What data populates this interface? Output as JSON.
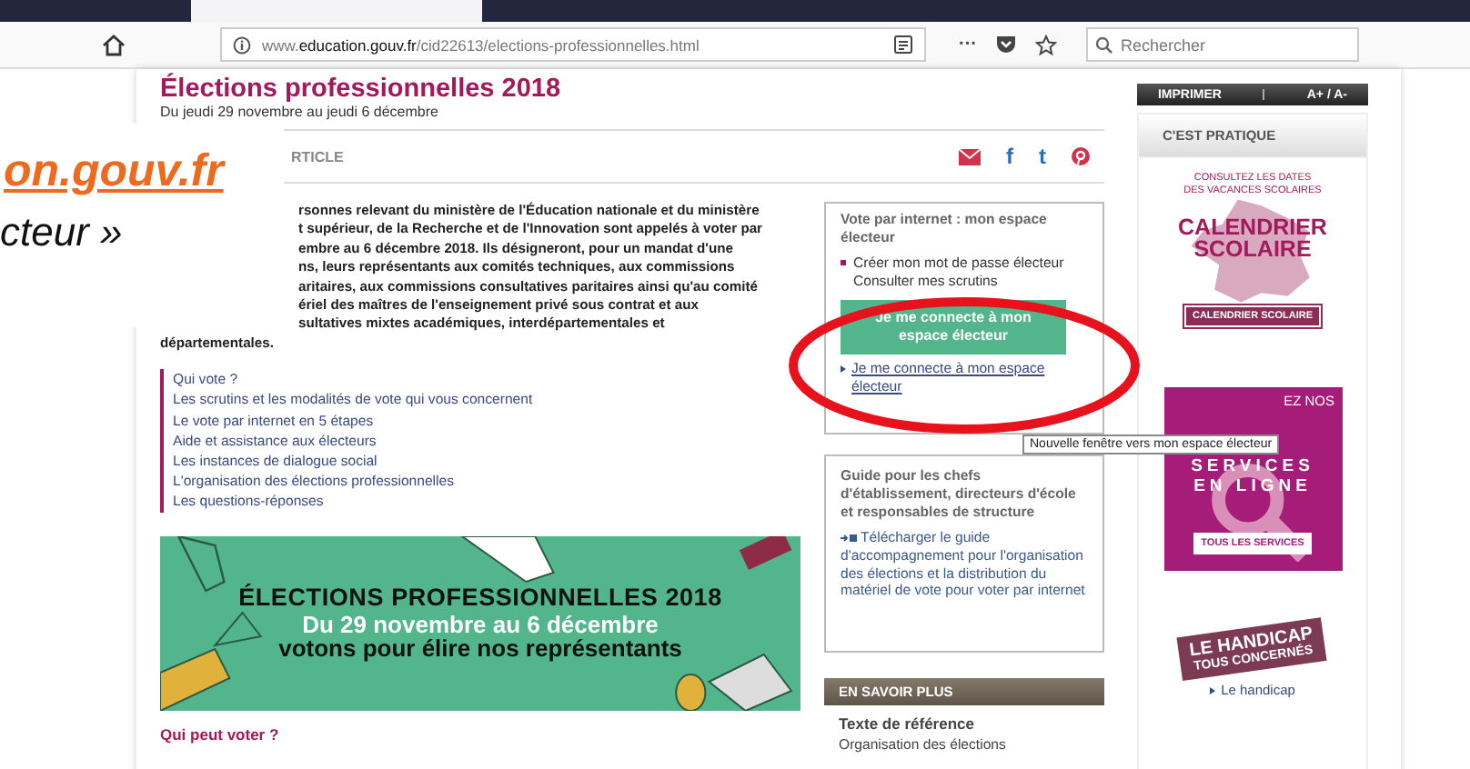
{
  "browser": {
    "url_prefix": "www.",
    "url_domain": "education.gouv.fr",
    "url_path": "/cid22613/elections-professionnelles.html",
    "more": "···",
    "search_placeholder": "Rechercher"
  },
  "overlay": {
    "link": "on.gouv.fr",
    "caption": "cteur »"
  },
  "article": {
    "title": "Élections professionnelles 2018",
    "dates": "Du jeudi 29 novembre au jeudi 6 décembre",
    "section": "RTICLE",
    "share_letters": [
      "f",
      "t"
    ],
    "intro_lines": [
      "rsonnes relevant du ministère de l'Éducation nationale et du ministère",
      "t supérieur, de la Recherche et de l'Innovation sont appelés à voter par",
      "embre au 6 décembre 2018. Ils désigneront, pour un mandat d'une",
      "ns, leurs représentants aux comités techniques, aux commissions",
      "aritaires, aux commissions consultatives paritaires ainsi qu'au comité",
      "ériel des maîtres de l'enseignement privé sous contrat et aux",
      "sultatives mixtes académiques, interdépartementales et"
    ],
    "intro_last": "départementales.",
    "links": [
      "Qui vote ?",
      "Les scrutins et les modalités de vote qui vous concernent",
      "Le vote par internet en 5 étapes",
      "Aide et assistance aux électeurs",
      "Les instances de dialogue social",
      "L'organisation des élections professionnelles",
      "Les questions-réponses"
    ],
    "banner": {
      "title": "ÉLECTIONS PROFESSIONNELLES 2018",
      "dates": "Du 29 novembre au 6 décembre",
      "slogan": "votons pour élire nos représentants"
    },
    "subheading": "Qui peut voter ?"
  },
  "vote_box": {
    "title": "Vote par internet : mon espace électeur",
    "items": [
      {
        "text": "Créer mon mot de passe électeur",
        "bullet": true
      },
      {
        "text": "Consulter mes scrutins",
        "bullet": false
      }
    ],
    "button": "Je me connecte à mon espace électeur",
    "link": "Je me connecte à mon espace électeur"
  },
  "tooltip": "Nouvelle fenêtre vers mon espace électeur",
  "guide_box": {
    "title": "Guide pour les chefs d'établissement, directeurs d'école et responsables de structure",
    "link": "Télécharger le guide d'accompagnement pour l'organisation des élections et la distribution du matériel de vote pour voter par internet"
  },
  "more": {
    "header": "EN SAVOIR PLUS",
    "title": "Texte de référence",
    "text": "Organisation des élections"
  },
  "sidebar": {
    "print": "IMPRIMER",
    "font_size": "A+ / A-",
    "header": "C'EST PRATIQUE",
    "calendar": {
      "caption_lines": [
        "CONSULTEZ LES DATES",
        "DES VACANCES SCOLAIRES"
      ],
      "logo_lines": [
        "CALENDRIER",
        "SCOLAIRE"
      ],
      "button": "CALENDRIER SCOLAIRE"
    },
    "services": {
      "lines": [
        "EZ NOS",
        "SERVICES",
        "EN LIGNE"
      ],
      "button": "TOUS LES SERVICES"
    },
    "handicap": {
      "lines": [
        "LE HANDICAP",
        "TOUS CONCERNÉS"
      ],
      "link": "Le handicap"
    }
  }
}
